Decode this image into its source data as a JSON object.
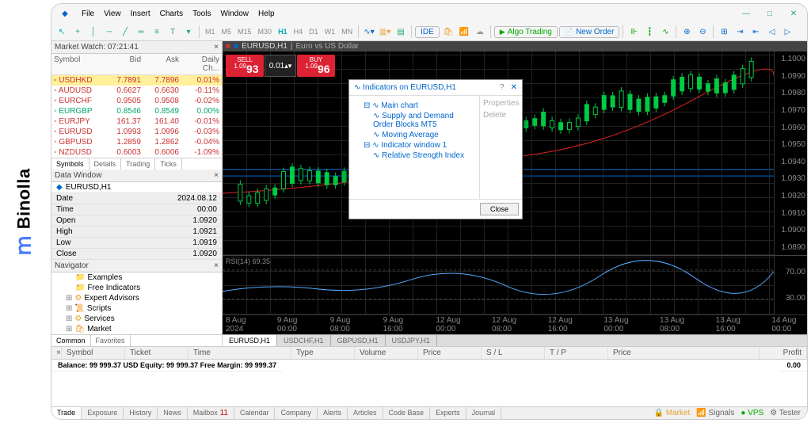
{
  "brand": "Binolla",
  "menu": [
    "File",
    "View",
    "Insert",
    "Charts",
    "Tools",
    "Window",
    "Help"
  ],
  "timeframes": [
    "M1",
    "M5",
    "M15",
    "M30",
    "H1",
    "H4",
    "D1",
    "W1",
    "MN"
  ],
  "tf_active": "H1",
  "algo_btn": "Algo Trading",
  "new_order_btn": "New Order",
  "ide_btn": "IDE",
  "market_watch": {
    "title": "Market Watch: 07:21:41",
    "cols": [
      "Symbol",
      "Bid",
      "Ask",
      "Daily Ch..."
    ],
    "rows": [
      {
        "sym": "USDHKD",
        "bid": "7.7891",
        "ask": "7.7896",
        "chg": "0.01%",
        "hl": true,
        "cls": "r-dn"
      },
      {
        "sym": "AUDUSD",
        "bid": "0.6627",
        "ask": "0.6630",
        "chg": "-0.11%",
        "cls": "r-dn"
      },
      {
        "sym": "EURCHF",
        "bid": "0.9505",
        "ask": "0.9508",
        "chg": "-0.02%",
        "cls": "r-dn"
      },
      {
        "sym": "EURGBP",
        "bid": "0.8546",
        "ask": "0.8549",
        "chg": "0.00%",
        "cls": "r-up"
      },
      {
        "sym": "EURJPY",
        "bid": "161.37",
        "ask": "161.40",
        "chg": "-0.01%",
        "cls": "r-dn"
      },
      {
        "sym": "EURUSD",
        "bid": "1.0993",
        "ask": "1.0996",
        "chg": "-0.03%",
        "cls": "r-dn"
      },
      {
        "sym": "GBPUSD",
        "bid": "1.2859",
        "ask": "1.2862",
        "chg": "-0.04%",
        "cls": "r-dn"
      },
      {
        "sym": "NZDUSD",
        "bid": "0.6003",
        "ask": "0.6006",
        "chg": "-1.09%",
        "cls": "r-dn"
      }
    ],
    "tabs": [
      "Symbols",
      "Details",
      "Trading",
      "Ticks"
    ]
  },
  "data_window": {
    "title": "Data Window",
    "symbol": "EURUSD,H1",
    "rows": [
      [
        "Date",
        "2024.08.12"
      ],
      [
        "Time",
        "00:00"
      ],
      [
        "Open",
        "1.0920"
      ],
      [
        "High",
        "1.0921"
      ],
      [
        "Low",
        "1.0919"
      ],
      [
        "Close",
        "1.0920"
      ]
    ]
  },
  "navigator": {
    "title": "Navigator",
    "items": [
      "Examples",
      "Free Indicators",
      "Expert Advisors",
      "Scripts",
      "Services",
      "Market"
    ],
    "tabs": [
      "Common",
      "Favorites"
    ]
  },
  "chart": {
    "title": "EURUSD,H1",
    "subtitle": "Euro vs US Dollar",
    "sell": {
      "label": "SELL",
      "small": "1.09",
      "big": "93"
    },
    "vol": "0.01",
    "buy": {
      "label": "BUY",
      "small": "1.09",
      "big": "96"
    },
    "rsi_label": "RSI(14) 69.35",
    "yaxis": [
      "1.1000",
      "1.0990",
      "1.0980",
      "1.0970",
      "1.0960",
      "1.0950",
      "1.0940",
      "1.0930",
      "1.0920",
      "1.0910",
      "1.0900",
      "1.0890"
    ],
    "rsi_yaxis": [
      "70.00",
      "30.00"
    ],
    "xaxis": [
      "8 Aug 2024",
      "9 Aug 00:00",
      "9 Aug 08:00",
      "9 Aug 16:00",
      "12 Aug 00:00",
      "12 Aug 08:00",
      "12 Aug 16:00",
      "13 Aug 00:00",
      "13 Aug 08:00",
      "13 Aug 16:00",
      "14 Aug 00:00"
    ],
    "bottom_tabs": [
      "EURUSD,H1",
      "USDCHF,H1",
      "GBPUSD,H1",
      "USDJPY,H1"
    ]
  },
  "dialog": {
    "title": "Indicators on EURUSD,H1",
    "tree": [
      "Main chart",
      "Supply and Demand Order Blocks MT5",
      "Moving Average",
      "Indicator window 1",
      "Relative Strength Index"
    ],
    "side": [
      "Properties",
      "Delete"
    ],
    "close": "Close"
  },
  "terminal": {
    "cols": [
      "Symbol",
      "Ticket",
      "Time",
      "Type",
      "Volume",
      "Price",
      "S / L",
      "T / P",
      "Price",
      "Profit"
    ],
    "balance": "Balance: 99 999.37 USD   Equity: 99 999.37   Free Margin: 99 999.37",
    "profit": "0.00",
    "tabs": [
      "Trade",
      "Exposure",
      "History",
      "News",
      "Mailbox",
      "Calendar",
      "Company",
      "Alerts",
      "Articles",
      "Code Base",
      "Experts",
      "Journal"
    ],
    "mailbox_badge": "11",
    "right": [
      "Market",
      "Signals",
      "VPS",
      "Tester"
    ]
  }
}
